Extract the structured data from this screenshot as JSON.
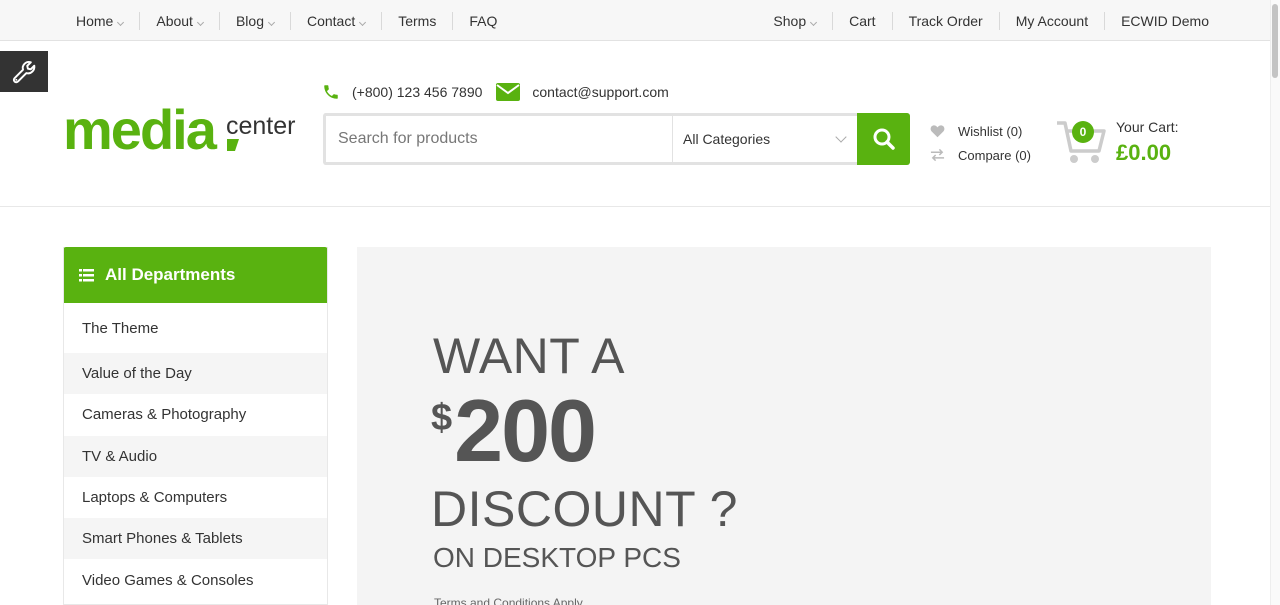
{
  "top_nav": {
    "left": [
      {
        "label": "Home",
        "dropdown": true
      },
      {
        "label": "About",
        "dropdown": true
      },
      {
        "label": "Blog",
        "dropdown": true
      },
      {
        "label": "Contact",
        "dropdown": true
      },
      {
        "label": "Terms",
        "dropdown": false
      },
      {
        "label": "FAQ",
        "dropdown": false
      }
    ],
    "right": [
      {
        "label": "Shop",
        "dropdown": true
      },
      {
        "label": "Cart",
        "dropdown": false
      },
      {
        "label": "Track Order",
        "dropdown": false
      },
      {
        "label": "My Account",
        "dropdown": false
      },
      {
        "label": "ECWID Demo",
        "dropdown": false
      }
    ]
  },
  "tool_button": {
    "icon": "wrench-icon"
  },
  "logo": {
    "primary": "media",
    "secondary": "center"
  },
  "contact": {
    "phone": "(+800) 123 456 7890",
    "email": "contact@support.com"
  },
  "search": {
    "placeholder": "Search for products",
    "category": "All Categories",
    "button_icon": "search-icon"
  },
  "wishlist": {
    "label": "Wishlist (0)"
  },
  "compare": {
    "label": "Compare (0)"
  },
  "cart": {
    "count": "0",
    "label": "Your Cart:",
    "total": "£0.00"
  },
  "departments": {
    "title": "All Departments",
    "items": [
      "The Theme",
      "Value of the Day",
      "Cameras & Photography",
      "TV & Audio",
      "Laptops & Computers",
      "Smart Phones & Tablets",
      "Video Games & Consoles"
    ]
  },
  "banner": {
    "line1": "WANT A",
    "currency": "$",
    "amount": "200",
    "line2": "DISCOUNT ?",
    "line3": "ON DESKTOP PCS",
    "terms": "Terms and Conditions Apply"
  },
  "colors": {
    "accent": "#59b210",
    "text": "#333333",
    "banner_bg": "#f4f4f4"
  }
}
